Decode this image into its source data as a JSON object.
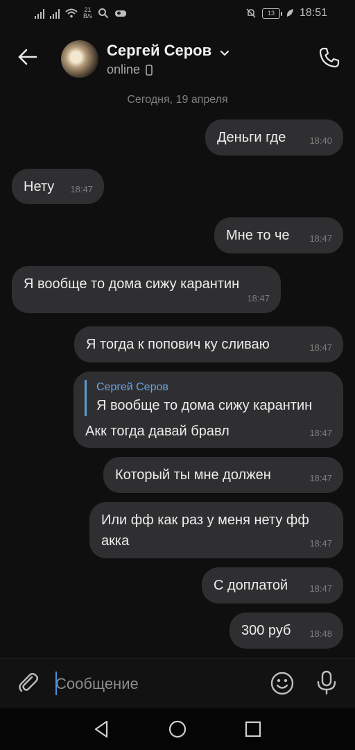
{
  "status_bar": {
    "net_speed_value": "21",
    "net_speed_unit": "B/s",
    "battery": "13",
    "time": "18:51"
  },
  "header": {
    "contact_name": "Сергей Серов",
    "status": "online"
  },
  "date_separator": "Сегодня, 19 апреля",
  "messages": [
    {
      "text": "Деньги где",
      "time": "18:40"
    },
    {
      "text": "Нету",
      "time": "18:47"
    },
    {
      "text": "Мне то че",
      "time": "18:47"
    },
    {
      "text": "Я вообще то дома сижу карантин",
      "time": "18:47"
    },
    {
      "text": "Я тогда к попович ку сливаю",
      "time": "18:47"
    },
    {
      "reply_author": "Сергей Серов",
      "reply_text": "Я вообще то дома сижу карантин",
      "text": "Акк тогда давай бравл",
      "time": "18:47"
    },
    {
      "text": "Который ты мне должен",
      "time": "18:47"
    },
    {
      "line1": "Или фф как раз у меня нету фф",
      "line2": "акка",
      "time": "18:47"
    },
    {
      "text": "С доплатой",
      "time": "18:47"
    },
    {
      "text": "300 руб",
      "time": "18:48"
    }
  ],
  "composer": {
    "placeholder": "Сообщение"
  },
  "colors": {
    "background": "#0f0f0f",
    "bubble": "#2f2f31",
    "accent": "#6aa5e6"
  },
  "icons": [
    "back-arrow-icon",
    "phone-icon",
    "paperclip-icon",
    "emoji-icon",
    "microphone-icon",
    "nav-back-icon",
    "nav-home-icon",
    "nav-recents-icon"
  ]
}
